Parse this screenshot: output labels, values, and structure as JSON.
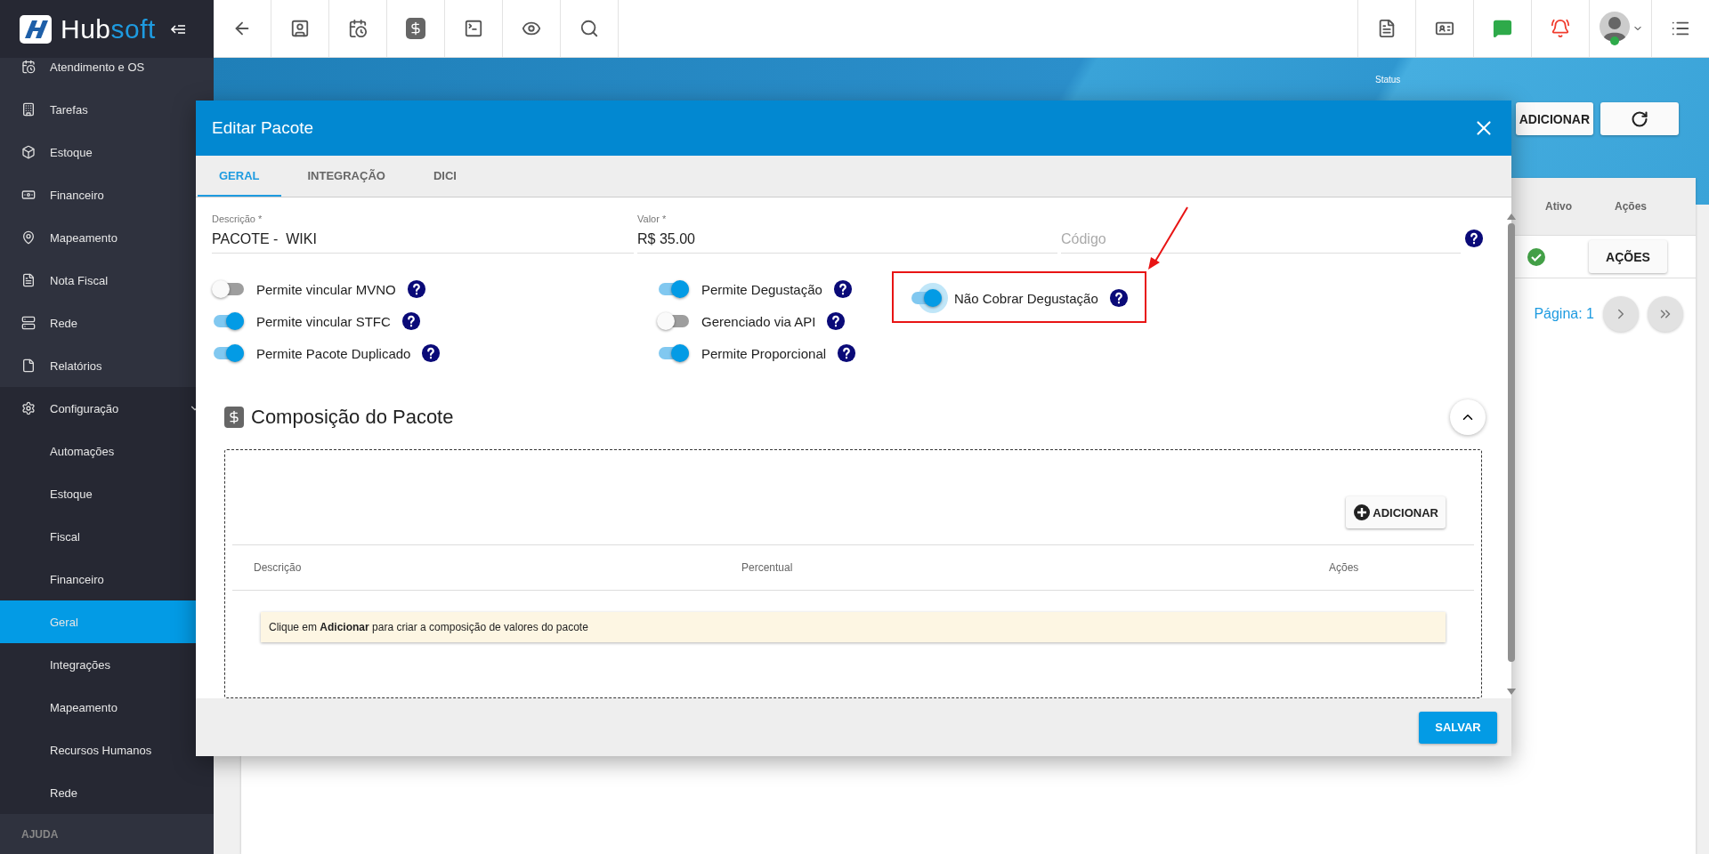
{
  "topbar": {
    "logo": {
      "part_1": "Hub",
      "part_2": "soft"
    }
  },
  "sidebar": {
    "items": [
      {
        "label": "Atendimento e OS",
        "selected": false
      },
      {
        "label": "Tarefas",
        "selected": false
      },
      {
        "label": "Estoque",
        "selected": false
      },
      {
        "label": "Financeiro",
        "selected": false
      },
      {
        "label": "Mapeamento",
        "selected": false
      },
      {
        "label": "Nota Fiscal",
        "selected": false
      },
      {
        "label": "Rede",
        "selected": false
      },
      {
        "label": "Relatórios",
        "selected": false
      },
      {
        "label": "Configuração",
        "selected": false,
        "expanded": true,
        "children": [
          {
            "label": "Automações",
            "selected": false
          },
          {
            "label": "Estoque",
            "selected": false
          },
          {
            "label": "Fiscal",
            "selected": false
          },
          {
            "label": "Financeiro",
            "selected": false
          },
          {
            "label": "Geral",
            "selected": true
          },
          {
            "label": "Integrações",
            "selected": false
          },
          {
            "label": "Mapeamento",
            "selected": false
          },
          {
            "label": "Recursos Humanos",
            "selected": false
          },
          {
            "label": "Rede",
            "selected": false
          }
        ]
      }
    ],
    "section": "AJUDA"
  },
  "page": {
    "status_label": "Status",
    "add_button": "ADICIONAR",
    "table": {
      "columns": [
        "Ativo",
        "Ações"
      ],
      "rows": [
        {
          "active": true,
          "action": "AÇÕES"
        }
      ]
    },
    "pagination": {
      "label": "Página: 1"
    }
  },
  "modal": {
    "title": "Editar Pacote",
    "tabs": [
      {
        "label": "GERAL",
        "selected": true
      },
      {
        "label": "INTEGRAÇÃO",
        "selected": false
      },
      {
        "label": "DICI",
        "selected": false
      }
    ],
    "fields": [
      {
        "label": "Descrição *",
        "value": "PACOTE -  WIKI"
      },
      {
        "label": "Valor *",
        "value": "R$ 35.00"
      },
      {
        "placeholder": "Código"
      }
    ],
    "toggle_columns": [
      {
        "toggles": [
          {
            "label": "Permite vincular MVNO",
            "on": false,
            "focused": false,
            "highlighted": false
          },
          {
            "label": "Permite vincular STFC",
            "on": true,
            "focused": false,
            "highlighted": false
          },
          {
            "label": "Permite Pacote Duplicado",
            "on": true,
            "focused": false,
            "highlighted": false
          }
        ]
      },
      {
        "toggles": [
          {
            "label": "Permite Degustação",
            "on": true,
            "focused": false,
            "highlighted": false
          },
          {
            "label": "Gerenciado via API",
            "on": false,
            "focused": false,
            "highlighted": false
          },
          {
            "label": "Permite Proporcional",
            "on": true,
            "focused": false,
            "highlighted": false
          }
        ]
      },
      {
        "toggles": [
          {
            "label": "Não Cobrar Degustação",
            "on": true,
            "focused": true,
            "highlighted": true
          }
        ]
      }
    ],
    "composition": {
      "title": "Composição do Pacote",
      "add_button": "ADICIONAR",
      "columns": [
        "Descrição",
        "Percentual",
        "Ações"
      ],
      "empty_message": "Clique em **Adicionar** para criar a composição de valores do pacote"
    },
    "save_button": "SALVAR"
  }
}
